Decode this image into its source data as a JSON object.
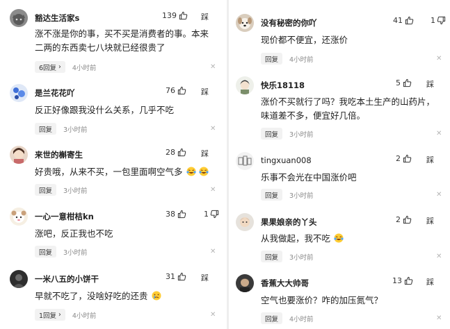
{
  "comments_left": [
    {
      "username": "豁达生活家s",
      "likes": "139",
      "dislike_label": "踩",
      "text_lines": [
        "涨不涨是你的事，买不买是消费者的事。本来",
        "二两的东西卖七八块就已经很贵了"
      ],
      "reply_label": "6回复",
      "time": "4小时前",
      "avatar": "cat-avatar"
    },
    {
      "username": "是兰花花吖",
      "likes": "76",
      "dislike_label": "踩",
      "text_lines": [
        "反正好像跟我没什么关系，几乎不吃"
      ],
      "reply_label": "回复",
      "time": "3小时前",
      "avatar": "blue-pattern-avatar"
    },
    {
      "username": "来世的槲寄生",
      "likes": "28",
      "dislike_label": "踩",
      "text_lines": [
        "好贵哦，从来不买，一包里面啊空气多"
      ],
      "reply_label": "回复",
      "time": "3小时前",
      "avatar": "girl-avatar"
    },
    {
      "username": "一心一意柑桔kn",
      "likes": "38",
      "dislike_label": "1",
      "text_lines": [
        "涨吧，反正我也不吃"
      ],
      "reply_label": "回复",
      "time": "3小时前",
      "avatar": "cartoon-avatar"
    },
    {
      "username": "一米八五的小饼干",
      "likes": "31",
      "dislike_label": "踩",
      "text_lines": [
        "早就不吃了，没啥好吃的还贵"
      ],
      "reply_label": "1回复",
      "time": "4小时前",
      "avatar": "dark-avatar"
    }
  ],
  "comments_right": [
    {
      "username": "没有秘密的你吖",
      "likes": "41",
      "dislike_label": "1",
      "text_lines": [
        "现价都不便宜，还涨价"
      ],
      "reply_label": "回复",
      "time": "4小时前",
      "avatar": "dog-avatar"
    },
    {
      "username": "快乐18118",
      "likes": "5",
      "dislike_label": "踩",
      "text_lines": [
        "涨价不买就行了吗？我吃本土生产的山药片，",
        "味道差不多，便宜好几倍。"
      ],
      "reply_label": "回复",
      "time": "3小时前",
      "avatar": "anime-avatar"
    },
    {
      "username": "tingxuan008",
      "likes": "2",
      "dislike_label": "踩",
      "text_lines": [
        "乐事不会光在中国涨价吧"
      ],
      "reply_label": "回复",
      "time": "3小时前",
      "avatar": "sketch-avatar"
    },
    {
      "username": "果果娘亲的丫头",
      "likes": "2",
      "dislike_label": "踩",
      "text_lines": [
        "从我做起，我不吃"
      ],
      "reply_label": "回复",
      "time": "3小时前",
      "avatar": "child-avatar"
    },
    {
      "username": "香蕉大大帅哥",
      "likes": "13",
      "dislike_label": "踩",
      "text_lines": [
        "空气也要涨价？咋的加压氮气？"
      ],
      "reply_label": "回复",
      "time": "4小时前",
      "avatar": "photo-avatar"
    }
  ],
  "colors": {
    "divider": "#eeeeee",
    "reply_bg": "#f2f2f2",
    "time": "#8a8a8a"
  }
}
